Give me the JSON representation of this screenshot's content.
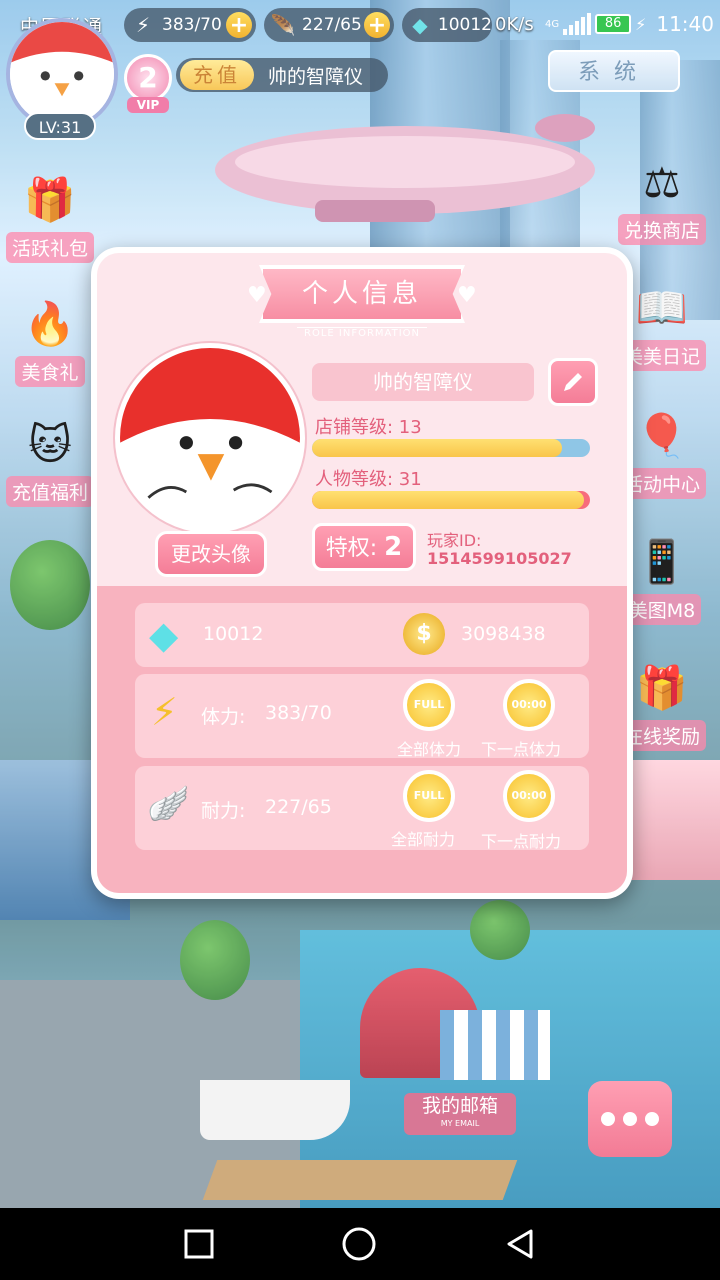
{
  "status": {
    "carrier": "中国联通",
    "stamina": "383/70",
    "endurance": "227/65",
    "diamonds": "10012",
    "net_speed": "0K/s",
    "net_type": "4G",
    "battery": "86",
    "time": "11:40"
  },
  "player": {
    "level_badge": "LV:31",
    "vip_level": "2",
    "vip_text": "VIP",
    "recharge_label": "充值",
    "name": "帅的智障仪"
  },
  "system_button": "系统",
  "side_left": [
    "活跃礼包",
    "美食礼",
    "充值福利"
  ],
  "side_right": [
    "兑换商店",
    "美美日记",
    "活动中心",
    "美图M8",
    "在线奖励"
  ],
  "dialog": {
    "title": "个人信息",
    "subtitle": "ROLE INFORMATION",
    "change_avatar": "更改头像",
    "name": "帅的智障仪",
    "shop_level_label": "店铺等级: 13",
    "shop_level_progress": 0.9,
    "char_level_label": "人物等级: 31",
    "char_level_progress": 0.98,
    "privilege_label": "特权:",
    "privilege_value": "2",
    "player_id_label": "玩家ID:",
    "player_id": "1514599105027",
    "diamonds": "10012",
    "gold": "3098438",
    "stamina_label": "体力:",
    "stamina_value": "383/70",
    "endurance_label": "耐力:",
    "endurance_value": "227/65",
    "full_text": "FULL",
    "timer_text": "00:00",
    "all_stamina": "全部体力",
    "next_stamina": "下一点体力",
    "all_endurance": "全部耐力",
    "next_endurance": "下一点耐力"
  },
  "mailbox": {
    "label": "我的邮箱",
    "sub": "MY EMAIL"
  },
  "colors": {
    "pink": "#f47d97",
    "panel": "#fde7ec",
    "gold": "#f8c02b"
  }
}
